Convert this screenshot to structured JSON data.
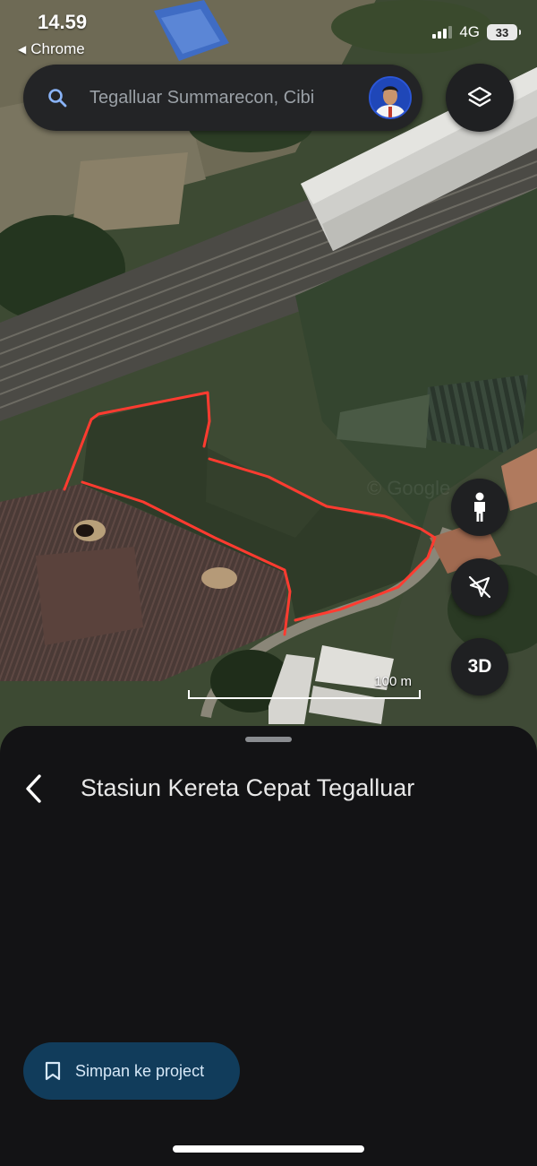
{
  "status_bar": {
    "time": "14.59",
    "back_app": "Chrome",
    "network": "4G",
    "battery": "33"
  },
  "search": {
    "placeholder": "Tegalluar Summarecon, Cibi",
    "value": "Tegalluar Summarecon, Cibi"
  },
  "map": {
    "scale_label": "100 m",
    "watermark": "Google",
    "fab_3d_label": "3D",
    "annotation_color": "#ff3b30"
  },
  "sheet": {
    "title": "Stasiun Kereta Cepat Tegalluar",
    "save_label": "Simpan ke project"
  },
  "colors": {
    "sheet_bg": "#131315",
    "save_button_bg": "#113c5b",
    "annotation": "#ff3b30"
  },
  "icons": {
    "search": "search-icon",
    "layers": "layers-icon",
    "pegman": "pegman-icon",
    "compass": "compass-off-icon",
    "back": "chevron-left-icon",
    "bookmark": "bookmark-icon"
  }
}
